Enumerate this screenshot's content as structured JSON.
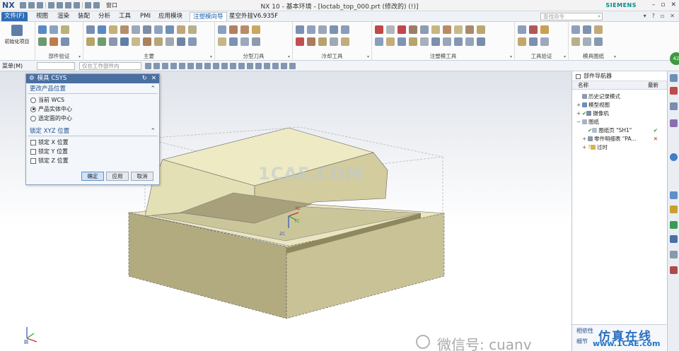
{
  "titlebar": {
    "logo": "NX",
    "window_menu": "窗口",
    "title": "NX 10 - 基本环境 - [loctab_top_000.prt (修改的) (!)]",
    "brand": "SIEMENS"
  },
  "tabs": [
    {
      "label": "文件(F)"
    },
    {
      "label": "视图"
    },
    {
      "label": "渲染"
    },
    {
      "label": "装配"
    },
    {
      "label": "分析"
    },
    {
      "label": "工具"
    },
    {
      "label": "PMI"
    },
    {
      "label": "应用模块"
    },
    {
      "label": "注塑模向导"
    },
    {
      "label": "星空外挂V6.935F"
    }
  ],
  "command_search": {
    "placeholder": "查找命令"
  },
  "ribbon": {
    "init_label": "初始化项目",
    "groups": [
      {
        "label": "部件验证"
      },
      {
        "label": "主要"
      },
      {
        "label": "分型刀具"
      },
      {
        "label": "冷却工具"
      },
      {
        "label": "注塑模工具"
      },
      {
        "label": "工具验证"
      },
      {
        "label": "模具图纸"
      }
    ]
  },
  "toolbar2": {
    "menu_label": "菜单(M)",
    "filter_placeholder": "仅在工作部件内"
  },
  "dialog": {
    "title": "模具 CSYS",
    "section1": "更改产品位置",
    "options": [
      "当前 WCS",
      "产品实体中心",
      "选定面的中心"
    ],
    "selected_option": 1,
    "section2": "锁定 XYZ 位置",
    "locks": [
      "锁定 X 位置",
      "锁定 Y 位置",
      "锁定 Z 位置"
    ],
    "buttons": {
      "ok": "确定",
      "apply": "应用",
      "cancel": "取消"
    }
  },
  "navigator": {
    "title": "部件导航器",
    "col_name": "名称",
    "col_latest": "最新",
    "rows": [
      {
        "label": "历史记录模式",
        "level": 0,
        "expander": ""
      },
      {
        "label": "模型视图",
        "level": 0,
        "expander": "+"
      },
      {
        "label": "摄像机",
        "level": 0,
        "expander": "+"
      },
      {
        "label": "图纸",
        "level": 0,
        "expander": "−"
      },
      {
        "label": "图纸页 \"SH1\"",
        "level": 1,
        "expander": "",
        "status": "✔"
      },
      {
        "label": "零件明细表 \"PA...",
        "level": 1,
        "expander": "+",
        "status": "✕"
      },
      {
        "label": "过时",
        "level": 1,
        "expander": "+"
      }
    ],
    "bottom": [
      "相依性",
      "细节"
    ]
  },
  "resource_bar": {
    "badge": "42"
  },
  "viewport": {
    "axis_labels": {
      "x": "XC",
      "y": "YC",
      "z": "ZC"
    }
  },
  "watermarks": {
    "center": "1CAE.COM",
    "wechat": "微信号: cuanv",
    "cn": "仿真在线",
    "site": "www.1CAE.com"
  },
  "colors": {
    "accent": "#2f6db3",
    "model_body": "#e8e4b8",
    "model_side": "#b5ad80"
  }
}
